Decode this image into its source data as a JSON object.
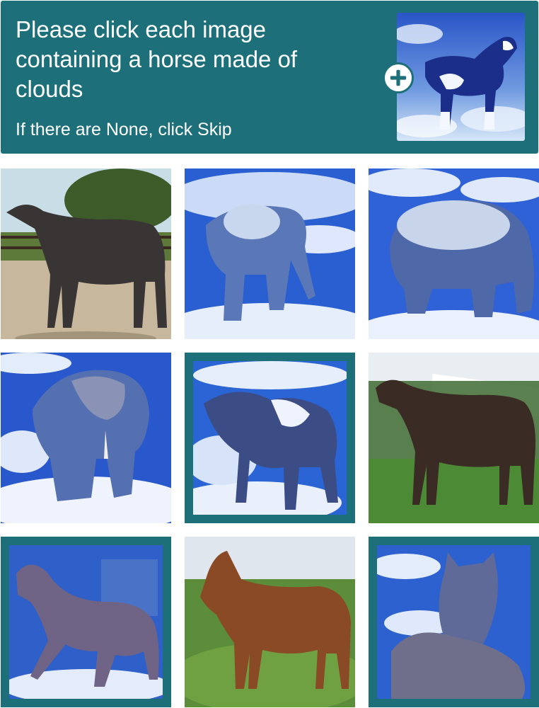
{
  "header": {
    "prompt": "Please click each image containing a horse made of clouds",
    "subprompt": "If there are None, click Skip",
    "example_image": "cloud-horse-example",
    "plus_icon": "plus-icon",
    "accent_color": "#1d7079"
  },
  "grid": {
    "tiles": [
      {
        "subject": "dark-horse-photo",
        "selected": false
      },
      {
        "subject": "cloud-elephant-walking",
        "selected": false
      },
      {
        "subject": "cloud-elephant",
        "selected": false
      },
      {
        "subject": "cloud-elephant-front",
        "selected": false
      },
      {
        "subject": "cloud-horse",
        "selected": true
      },
      {
        "subject": "brown-horse-photo-field",
        "selected": false
      },
      {
        "subject": "cloud-horse-trotting",
        "selected": true
      },
      {
        "subject": "chestnut-horse-photo-grass",
        "selected": false
      },
      {
        "subject": "cloud-horse-foal",
        "selected": true
      }
    ]
  }
}
